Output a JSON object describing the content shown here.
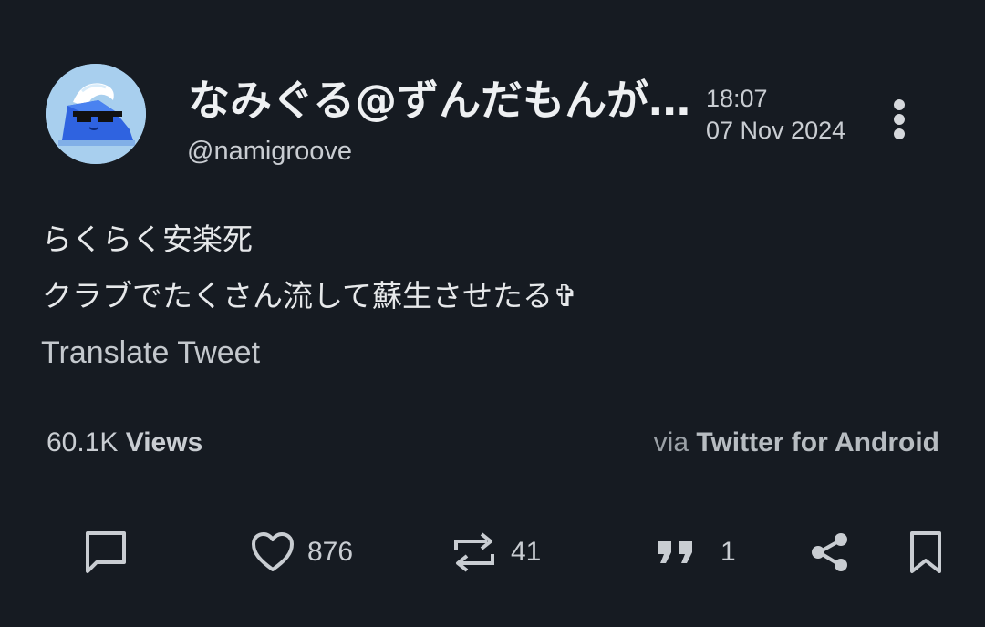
{
  "tweet": {
    "display_name": "なみぐる@ずんだもんが…",
    "handle": "@namigroove",
    "time": "18:07",
    "date": "07 Nov 2024",
    "text_lines": [
      "らくらく安楽死",
      "クラブでたくさん流して蘇生させたる✞"
    ],
    "translate_label": "Translate Tweet",
    "views_count": "60.1K",
    "views_label": "Views",
    "via_prefix": "via",
    "source": "Twitter for Android"
  },
  "actions": {
    "likes": "876",
    "retweets": "41",
    "quotes": "1"
  },
  "icons": {
    "more": "more-vertical-icon",
    "reply": "reply-icon",
    "like": "heart-icon",
    "retweet": "retweet-icon",
    "quote": "quote-icon",
    "share": "share-icon",
    "bookmark": "bookmark-icon"
  },
  "colors": {
    "background": "#161b22",
    "text": "#e6e8ea",
    "muted": "#c9cdd2",
    "avatar_bg": "#a8cfee"
  }
}
